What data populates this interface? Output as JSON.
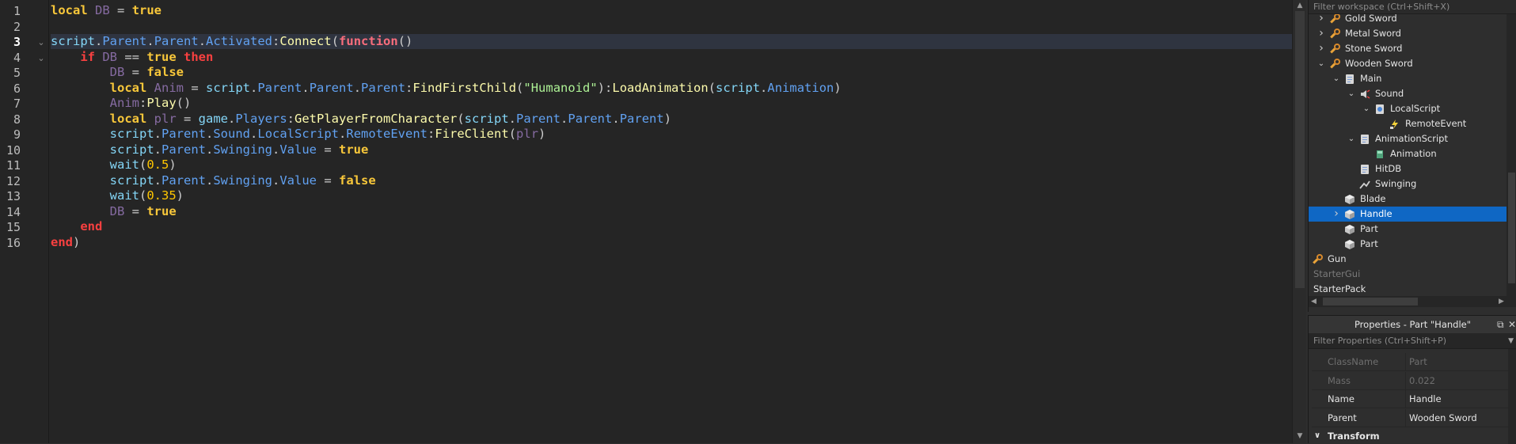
{
  "editor": {
    "current_line": 3,
    "lines": [
      {
        "n": "1",
        "tokens": [
          [
            "kw",
            "local"
          ],
          [
            "op",
            " "
          ],
          [
            "lv",
            "DB"
          ],
          [
            "op",
            " = "
          ],
          [
            "kw",
            "true"
          ]
        ]
      },
      {
        "n": "2",
        "tokens": []
      },
      {
        "n": "3",
        "tokens": [
          [
            "gl",
            "script"
          ],
          [
            "op",
            "."
          ],
          [
            "pr",
            "Parent"
          ],
          [
            "op",
            "."
          ],
          [
            "pr",
            "Parent"
          ],
          [
            "op",
            "."
          ],
          [
            "pr",
            "Activated"
          ],
          [
            "op",
            ":"
          ],
          [
            "fn",
            "Connect"
          ],
          [
            "op",
            "("
          ],
          [
            "kp",
            "function"
          ],
          [
            "op",
            "()"
          ]
        ]
      },
      {
        "n": "4",
        "tokens": [
          [
            "op",
            "    "
          ],
          [
            "kr",
            "if"
          ],
          [
            "op",
            " "
          ],
          [
            "lv",
            "DB"
          ],
          [
            "op",
            " == "
          ],
          [
            "kw",
            "true"
          ],
          [
            "op",
            " "
          ],
          [
            "kr",
            "then"
          ]
        ]
      },
      {
        "n": "5",
        "tokens": [
          [
            "op",
            "        "
          ],
          [
            "lv",
            "DB"
          ],
          [
            "op",
            " = "
          ],
          [
            "kw",
            "false"
          ]
        ]
      },
      {
        "n": "6",
        "tokens": [
          [
            "op",
            "        "
          ],
          [
            "kw",
            "local"
          ],
          [
            "op",
            " "
          ],
          [
            "lv",
            "Anim"
          ],
          [
            "op",
            " = "
          ],
          [
            "gl",
            "script"
          ],
          [
            "op",
            "."
          ],
          [
            "pr",
            "Parent"
          ],
          [
            "op",
            "."
          ],
          [
            "pr",
            "Parent"
          ],
          [
            "op",
            "."
          ],
          [
            "pr",
            "Parent"
          ],
          [
            "op",
            ":"
          ],
          [
            "fn",
            "FindFirstChild"
          ],
          [
            "op",
            "("
          ],
          [
            "st",
            "\"Humanoid\""
          ],
          [
            "op",
            "):"
          ],
          [
            "fn",
            "LoadAnimation"
          ],
          [
            "op",
            "("
          ],
          [
            "gl",
            "script"
          ],
          [
            "op",
            "."
          ],
          [
            "pr",
            "Animation"
          ],
          [
            "op",
            ")"
          ]
        ]
      },
      {
        "n": "7",
        "tokens": [
          [
            "op",
            "        "
          ],
          [
            "lv",
            "Anim"
          ],
          [
            "op",
            ":"
          ],
          [
            "fn",
            "Play"
          ],
          [
            "op",
            "()"
          ]
        ]
      },
      {
        "n": "8",
        "tokens": [
          [
            "op",
            "        "
          ],
          [
            "kw",
            "local"
          ],
          [
            "op",
            " "
          ],
          [
            "lv",
            "plr"
          ],
          [
            "op",
            " = "
          ],
          [
            "gl",
            "game"
          ],
          [
            "op",
            "."
          ],
          [
            "pr",
            "Players"
          ],
          [
            "op",
            ":"
          ],
          [
            "fn",
            "GetPlayerFromCharacter"
          ],
          [
            "op",
            "("
          ],
          [
            "gl",
            "script"
          ],
          [
            "op",
            "."
          ],
          [
            "pr",
            "Parent"
          ],
          [
            "op",
            "."
          ],
          [
            "pr",
            "Parent"
          ],
          [
            "op",
            "."
          ],
          [
            "pr",
            "Parent"
          ],
          [
            "op",
            ")"
          ]
        ]
      },
      {
        "n": "9",
        "tokens": [
          [
            "op",
            "        "
          ],
          [
            "gl",
            "script"
          ],
          [
            "op",
            "."
          ],
          [
            "pr",
            "Parent"
          ],
          [
            "op",
            "."
          ],
          [
            "pr",
            "Sound"
          ],
          [
            "op",
            "."
          ],
          [
            "pr",
            "LocalScript"
          ],
          [
            "op",
            "."
          ],
          [
            "pr",
            "RemoteEvent"
          ],
          [
            "op",
            ":"
          ],
          [
            "fn",
            "FireClient"
          ],
          [
            "op",
            "("
          ],
          [
            "lv",
            "plr"
          ],
          [
            "op",
            ")"
          ]
        ]
      },
      {
        "n": "10",
        "tokens": [
          [
            "op",
            "        "
          ],
          [
            "gl",
            "script"
          ],
          [
            "op",
            "."
          ],
          [
            "pr",
            "Parent"
          ],
          [
            "op",
            "."
          ],
          [
            "pr",
            "Swinging"
          ],
          [
            "op",
            "."
          ],
          [
            "pr",
            "Value"
          ],
          [
            "op",
            " = "
          ],
          [
            "kw",
            "true"
          ]
        ]
      },
      {
        "n": "11",
        "tokens": [
          [
            "op",
            "        "
          ],
          [
            "gl",
            "wait"
          ],
          [
            "op",
            "("
          ],
          [
            "nm",
            "0.5"
          ],
          [
            "op",
            ")"
          ]
        ]
      },
      {
        "n": "12",
        "tokens": [
          [
            "op",
            "        "
          ],
          [
            "gl",
            "script"
          ],
          [
            "op",
            "."
          ],
          [
            "pr",
            "Parent"
          ],
          [
            "op",
            "."
          ],
          [
            "pr",
            "Swinging"
          ],
          [
            "op",
            "."
          ],
          [
            "pr",
            "Value"
          ],
          [
            "op",
            " = "
          ],
          [
            "kw",
            "false"
          ]
        ]
      },
      {
        "n": "13",
        "tokens": [
          [
            "op",
            "        "
          ],
          [
            "gl",
            "wait"
          ],
          [
            "op",
            "("
          ],
          [
            "nm",
            "0.35"
          ],
          [
            "op",
            ")"
          ]
        ]
      },
      {
        "n": "14",
        "tokens": [
          [
            "op",
            "        "
          ],
          [
            "lv",
            "DB"
          ],
          [
            "op",
            " = "
          ],
          [
            "kw",
            "true"
          ]
        ]
      },
      {
        "n": "15",
        "tokens": [
          [
            "op",
            "    "
          ],
          [
            "kr",
            "end"
          ]
        ]
      },
      {
        "n": "16",
        "tokens": [
          [
            "kr",
            "end"
          ],
          [
            "op",
            ")"
          ]
        ]
      }
    ]
  },
  "explorer": {
    "filter_placeholder": "Filter workspace (Ctrl+Shift+X)",
    "items": [
      {
        "label": "Gold Sword",
        "depth": 0,
        "chevron": "right",
        "icon": "tool-icon"
      },
      {
        "label": "Metal Sword",
        "depth": 0,
        "chevron": "right",
        "icon": "tool-icon"
      },
      {
        "label": "Stone Sword",
        "depth": 0,
        "chevron": "right",
        "icon": "tool-icon"
      },
      {
        "label": "Wooden Sword",
        "depth": 0,
        "chevron": "down",
        "icon": "tool-icon"
      },
      {
        "label": "Main",
        "depth": 1,
        "chevron": "down",
        "icon": "script-icon"
      },
      {
        "label": "Sound",
        "depth": 2,
        "chevron": "down",
        "icon": "sound-icon"
      },
      {
        "label": "LocalScript",
        "depth": 3,
        "chevron": "down",
        "icon": "localscript-icon"
      },
      {
        "label": "RemoteEvent",
        "depth": 4,
        "chevron": "",
        "icon": "remoteevent-icon"
      },
      {
        "label": "AnimationScript",
        "depth": 2,
        "chevron": "down",
        "icon": "script-icon"
      },
      {
        "label": "Animation",
        "depth": 3,
        "chevron": "",
        "icon": "animation-icon"
      },
      {
        "label": "HitDB",
        "depth": 2,
        "chevron": "",
        "icon": "script-icon"
      },
      {
        "label": "Swinging",
        "depth": 2,
        "chevron": "",
        "icon": "boolvalue-icon"
      },
      {
        "label": "Blade",
        "depth": 1,
        "chevron": "",
        "icon": "part-icon"
      },
      {
        "label": "Handle",
        "depth": 1,
        "chevron": "right",
        "icon": "part-icon",
        "selected": true
      },
      {
        "label": "Part",
        "depth": 1,
        "chevron": "",
        "icon": "part-icon"
      },
      {
        "label": "Part",
        "depth": 1,
        "chevron": "",
        "icon": "part-icon"
      },
      {
        "label": "Gun",
        "depth": -1,
        "chevron": "",
        "icon": "tool-icon"
      },
      {
        "label": "StarterGui",
        "depth": -1,
        "chevron": "",
        "icon": "",
        "dim": true
      },
      {
        "label": "StarterPack",
        "depth": -1,
        "chevron": "",
        "icon": ""
      }
    ]
  },
  "properties": {
    "title": "Properties - Part \"Handle\"",
    "filter_placeholder": "Filter Properties (Ctrl+Shift+P)",
    "rows": [
      {
        "name": "ClassName",
        "value": "Part",
        "dim": true
      },
      {
        "name": "Mass",
        "value": "0.022",
        "dim": true
      },
      {
        "name": "Name",
        "value": "Handle",
        "dim": false
      },
      {
        "name": "Parent",
        "value": "Wooden Sword",
        "dim": false
      }
    ],
    "section": "Transform"
  }
}
